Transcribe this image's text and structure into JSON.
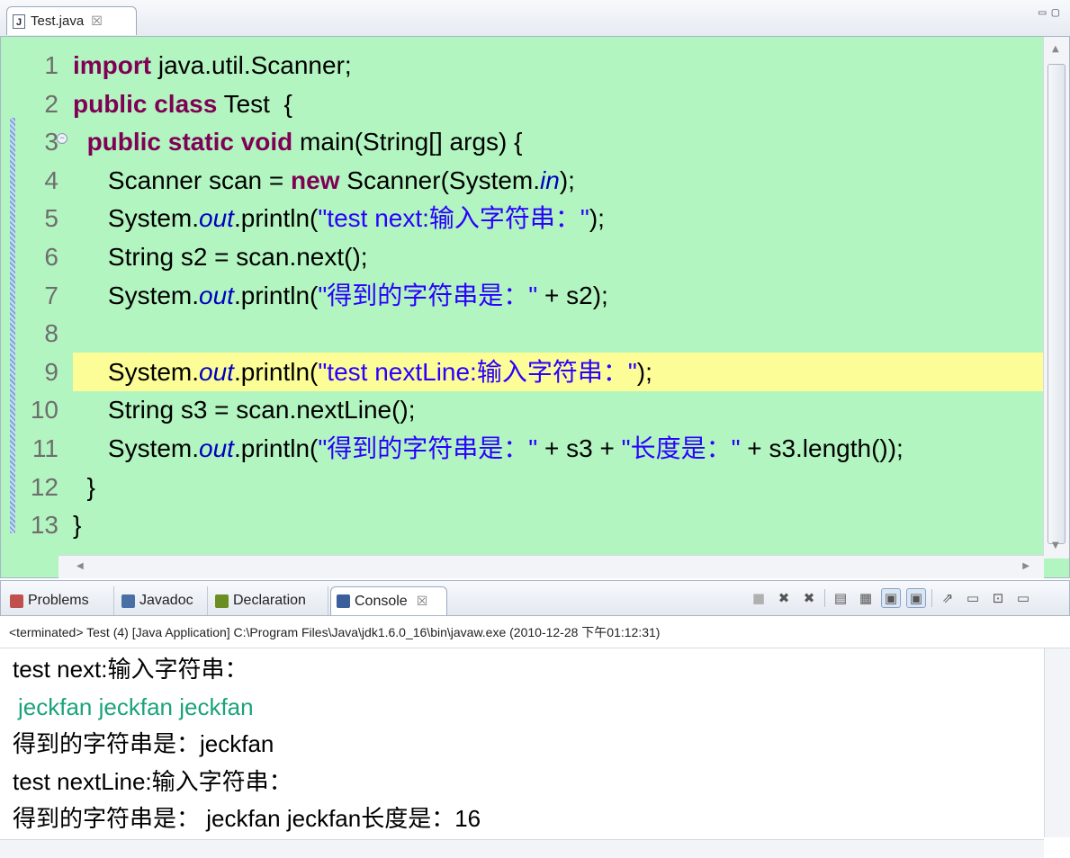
{
  "editor": {
    "tab_label": "Test.java",
    "tab_close": "☒",
    "window_buttons": "▭▢",
    "lines": [
      {
        "num": "1",
        "parts": [
          [
            "kw",
            "import"
          ],
          [
            "t",
            " java.util.Scanner;"
          ]
        ]
      },
      {
        "num": "2",
        "parts": [
          [
            "kw",
            "public class"
          ],
          [
            "t",
            " Test  {"
          ]
        ]
      },
      {
        "num": "3",
        "parts": [
          [
            "t",
            "  "
          ],
          [
            "kw",
            "public static void"
          ],
          [
            "t",
            " main(String[] args) {"
          ]
        ],
        "fold": true
      },
      {
        "num": "4",
        "parts": [
          [
            "t",
            "     Scanner scan = "
          ],
          [
            "kw",
            "new"
          ],
          [
            "t",
            " Scanner(System."
          ],
          [
            "fld",
            "in"
          ],
          [
            "t",
            ");"
          ]
        ]
      },
      {
        "num": "5",
        "parts": [
          [
            "t",
            "     System."
          ],
          [
            "fld",
            "out"
          ],
          [
            "t",
            ".println("
          ],
          [
            "str",
            "\"test next:输入字符串：\""
          ],
          [
            "t",
            ");"
          ]
        ]
      },
      {
        "num": "6",
        "parts": [
          [
            "t",
            "     String s2 = scan.next();"
          ]
        ]
      },
      {
        "num": "7",
        "parts": [
          [
            "t",
            "     System."
          ],
          [
            "fld",
            "out"
          ],
          [
            "t",
            ".println("
          ],
          [
            "str",
            "\"得到的字符串是：\""
          ],
          [
            "t",
            " + s2);"
          ]
        ]
      },
      {
        "num": "8",
        "parts": []
      },
      {
        "num": "9",
        "parts": [
          [
            "t",
            "     System."
          ],
          [
            "fld",
            "out"
          ],
          [
            "t",
            ".println("
          ],
          [
            "str",
            "\"test nextLine:输入字符串：\""
          ],
          [
            "t",
            ");"
          ]
        ],
        "highlight": true
      },
      {
        "num": "10",
        "parts": [
          [
            "t",
            "     String s3 = scan.nextLine();"
          ]
        ]
      },
      {
        "num": "11",
        "parts": [
          [
            "t",
            "     System."
          ],
          [
            "fld",
            "out"
          ],
          [
            "t",
            ".println("
          ],
          [
            "str",
            "\"得到的字符串是：\""
          ],
          [
            "t",
            " + s3 + "
          ],
          [
            "str",
            "\"长度是：\""
          ],
          [
            "t",
            " + s3.length());"
          ]
        ]
      },
      {
        "num": "12",
        "parts": [
          [
            "t",
            "  }"
          ]
        ]
      },
      {
        "num": "13",
        "parts": [
          [
            "t",
            "}"
          ]
        ]
      }
    ]
  },
  "console_view": {
    "tabs": [
      {
        "label": "Problems",
        "icon": "problems-icon",
        "color": "#c0504d"
      },
      {
        "label": "Javadoc",
        "icon": "javadoc-icon",
        "color": "#4a6fa5"
      },
      {
        "label": "Declaration",
        "icon": "declaration-icon",
        "color": "#6b8e23"
      },
      {
        "label": "Console",
        "icon": "console-icon",
        "color": "#3b5f9a",
        "active": true,
        "close": "☒"
      }
    ],
    "status": "<terminated> Test (4) [Java Application] C:\\Program Files\\Java\\jdk1.6.0_16\\bin\\javaw.exe (2010-12-28 下午01:12:31)",
    "output": [
      {
        "text": "test next:输入字符串：",
        "kind": "out"
      },
      {
        "text": "jeckfan jeckfan jeckfan",
        "kind": "in"
      },
      {
        "text": "得到的字符串是：jeckfan",
        "kind": "out"
      },
      {
        "text": "test nextLine:输入字符串：",
        "kind": "out"
      },
      {
        "text": "得到的字符串是： jeckfan jeckfan长度是：16",
        "kind": "out"
      }
    ],
    "toolbar_icons": [
      "terminate-icon",
      "remove-launch-icon",
      "remove-all-icon",
      "clear-console-icon",
      "scroll-lock-icon",
      "show-on-output-icon",
      "show-on-error-icon",
      "pin-console-icon",
      "display-console-icon",
      "open-console-icon",
      "minimize-icon"
    ]
  }
}
